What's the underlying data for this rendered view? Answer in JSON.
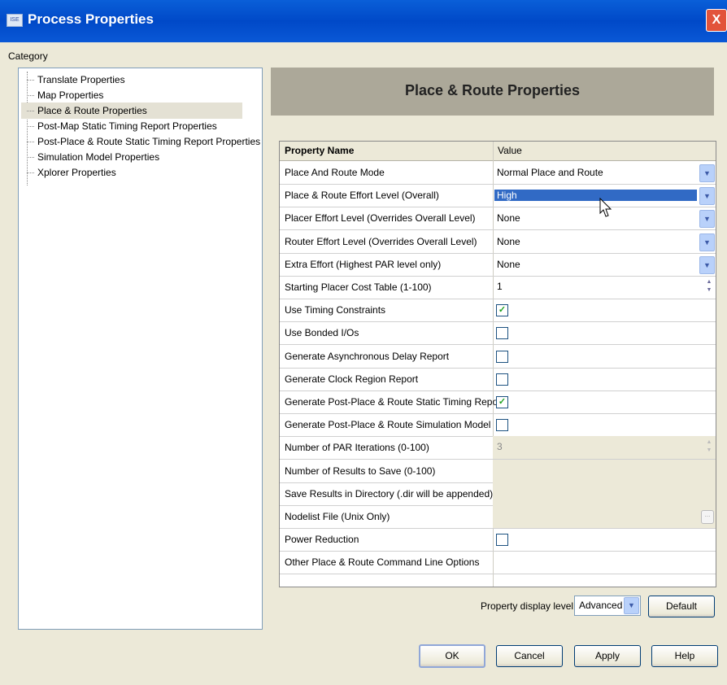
{
  "window": {
    "title": "Process Properties",
    "icon": "app-icon",
    "close_label": "X"
  },
  "category": {
    "label": "Category",
    "items": [
      {
        "label": "Translate Properties",
        "selected": false
      },
      {
        "label": "Map Properties",
        "selected": false
      },
      {
        "label": "Place & Route Properties",
        "selected": true
      },
      {
        "label": "Post-Map Static Timing Report Properties",
        "selected": false
      },
      {
        "label": "Post-Place & Route Static Timing Report Properties",
        "selected": false
      },
      {
        "label": "Simulation Model Properties",
        "selected": false
      },
      {
        "label": "Xplorer Properties",
        "selected": false
      }
    ]
  },
  "panel": {
    "title": "Place & Route Properties"
  },
  "grid": {
    "headers": {
      "name": "Property Name",
      "value": "Value"
    },
    "rows": [
      {
        "name": "Place And Route Mode",
        "type": "combo",
        "value": "Normal Place and Route"
      },
      {
        "name": "Place & Route Effort Level (Overall)",
        "type": "combo",
        "value": "High",
        "selected": true
      },
      {
        "name": "Placer Effort Level (Overrides Overall Level)",
        "type": "combo",
        "value": "None"
      },
      {
        "name": "Router Effort Level (Overrides Overall Level)",
        "type": "combo",
        "value": "None"
      },
      {
        "name": "Extra Effort (Highest PAR level only)",
        "type": "combo",
        "value": "None"
      },
      {
        "name": "Starting Placer Cost Table (1-100)",
        "type": "spin",
        "value": "1"
      },
      {
        "name": "Use Timing Constraints",
        "type": "check",
        "checked": true
      },
      {
        "name": "Use Bonded I/Os",
        "type": "check",
        "checked": false
      },
      {
        "name": "Generate Asynchronous Delay Report",
        "type": "check",
        "checked": false
      },
      {
        "name": "Generate Clock Region Report",
        "type": "check",
        "checked": false
      },
      {
        "name": "Generate Post-Place & Route Static Timing Report",
        "type": "check",
        "checked": true
      },
      {
        "name": "Generate Post-Place & Route Simulation Model",
        "type": "check",
        "checked": false
      },
      {
        "name": "Number of PAR Iterations (0-100)",
        "type": "spin-disabled",
        "value": "3"
      },
      {
        "name": "Number of Results to Save (0-100)",
        "type": "disabled",
        "value": ""
      },
      {
        "name": "Save Results in Directory (.dir will be appended)",
        "type": "disabled",
        "value": ""
      },
      {
        "name": "Nodelist File (Unix Only)",
        "type": "browse-disabled",
        "value": ""
      },
      {
        "name": "Power Reduction",
        "type": "check",
        "checked": false
      },
      {
        "name": "Other Place & Route Command Line Options",
        "type": "text",
        "value": ""
      }
    ]
  },
  "display_level": {
    "label": "Property display level:",
    "value": "Advanced"
  },
  "buttons": {
    "default": "Default",
    "ok": "OK",
    "cancel": "Cancel",
    "apply": "Apply",
    "help": "Help"
  },
  "colors": {
    "titlebar": "#0049c8",
    "selection": "#316ac5",
    "panel_header": "#aca899",
    "check": "#21a121"
  }
}
